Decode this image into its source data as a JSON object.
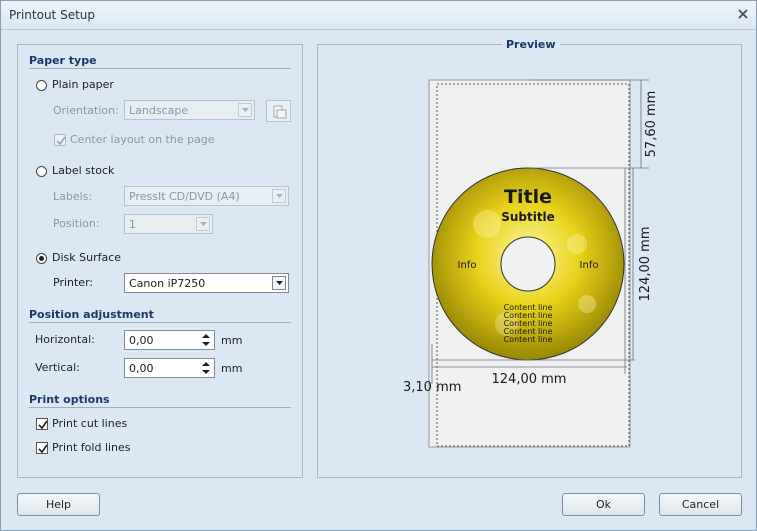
{
  "window": {
    "title": "Printout Setup"
  },
  "paper_type": {
    "heading": "Paper type",
    "plain_paper": {
      "label": "Plain paper",
      "selected": false
    },
    "orientation": {
      "label": "Orientation:",
      "value": "Landscape"
    },
    "center_layout": {
      "label": "Center layout on the page",
      "checked": true
    },
    "label_stock": {
      "label": "Label stock",
      "selected": false
    },
    "labels": {
      "label": "Labels:",
      "value": "PressIt CD/DVD (A4)"
    },
    "position": {
      "label": "Position:",
      "value": "1"
    },
    "disk_surface": {
      "label": "Disk Surface",
      "selected": true
    },
    "printer": {
      "label": "Printer:",
      "value": "Canon iP7250"
    }
  },
  "position_adjustment": {
    "heading": "Position adjustment",
    "horizontal": {
      "label": "Horizontal:",
      "value": "0,00",
      "unit": "mm"
    },
    "vertical": {
      "label": "Vertical:",
      "value": "0,00",
      "unit": "mm"
    }
  },
  "print_options": {
    "heading": "Print options",
    "cut_lines": {
      "label": "Print cut lines",
      "checked": true
    },
    "fold_lines": {
      "label": "Print fold lines",
      "checked": true
    }
  },
  "preview": {
    "heading": "Preview",
    "disc_title": "Title",
    "disc_subtitle": "Subtitle",
    "info_left": "Info",
    "info_right": "Info",
    "content_lines": [
      "Content line",
      "Content line",
      "Content line",
      "Content line",
      "Content line"
    ],
    "dim_top": "57,60 mm",
    "dim_right": "124,00 mm",
    "dim_bottom": "124,00 mm",
    "dim_left": "3,10 mm"
  },
  "buttons": {
    "help": "Help",
    "ok": "Ok",
    "cancel": "Cancel"
  },
  "colors": {
    "heading": "#1a3a66",
    "disc_gold": "#e8d21a",
    "background": "#dbe7f2"
  }
}
